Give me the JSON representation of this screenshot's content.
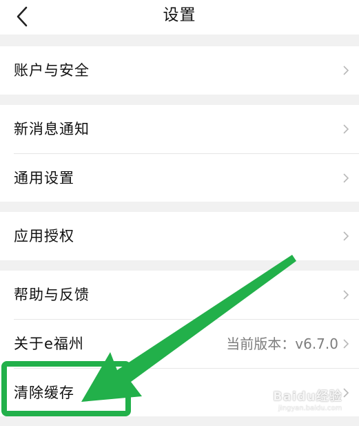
{
  "header": {
    "title": "设置",
    "back_icon": "chevron-left-icon"
  },
  "groups": [
    {
      "rows": [
        {
          "label": "账户与安全",
          "value": ""
        }
      ]
    },
    {
      "rows": [
        {
          "label": "新消息通知",
          "value": ""
        },
        {
          "label": "通用设置",
          "value": ""
        }
      ]
    },
    {
      "rows": [
        {
          "label": "应用授权",
          "value": ""
        }
      ]
    },
    {
      "rows": [
        {
          "label": "帮助与反馈",
          "value": ""
        },
        {
          "label": "关于e福州",
          "value": "当前版本：v6.7.0"
        },
        {
          "label": "清除缓存",
          "value": ""
        }
      ]
    }
  ],
  "colors": {
    "background": "#f1f1f1",
    "card": "#ffffff",
    "annotation_green": "#22b04a",
    "chevron": "#b8b8b8"
  },
  "watermark": {
    "text": "Baidu经验",
    "sub": "jingyan.baidu.com"
  }
}
